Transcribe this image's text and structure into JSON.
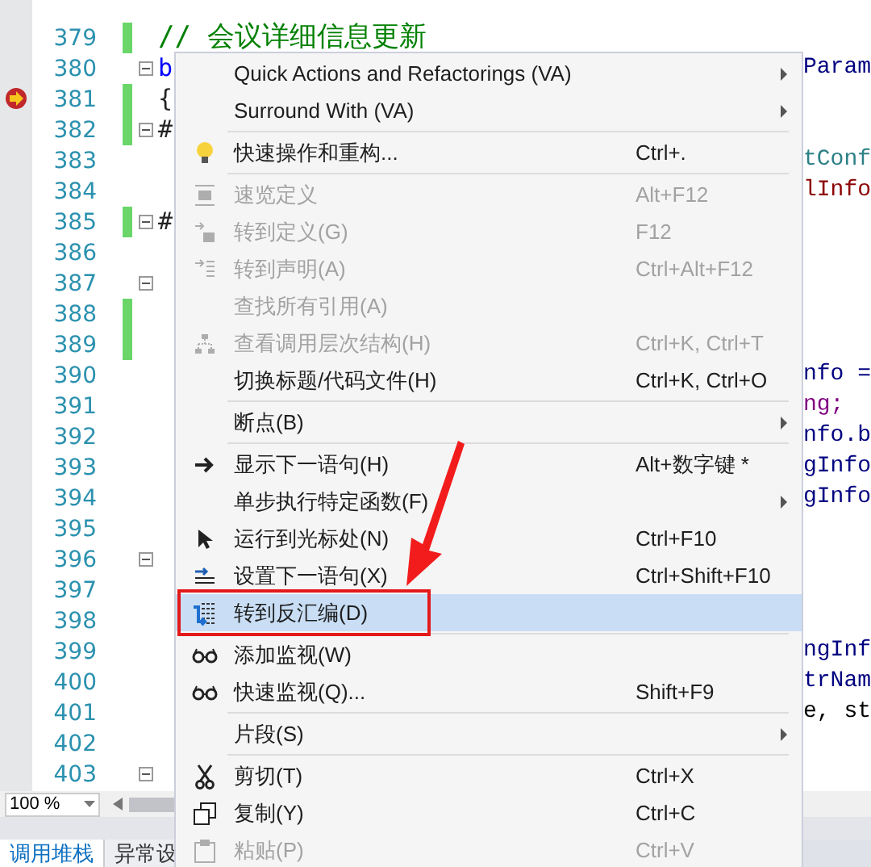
{
  "editor": {
    "lines": [
      {
        "number": "379",
        "changed": true,
        "code_left": {
          "text": "// 会议详细信息更新",
          "color": "#008000"
        }
      },
      {
        "number": "380",
        "fold": true,
        "code_left": {
          "text": "b",
          "color": "#0000ff"
        },
        "code_right": {
          "text": "Param",
          "color": "#000080"
        }
      },
      {
        "number": "381",
        "changed": true,
        "current": true,
        "code_left": {
          "text": "{",
          "color": "#222222"
        }
      },
      {
        "number": "382",
        "changed": true,
        "fold": true,
        "code_left": {
          "text": "#",
          "color": "#222222"
        }
      },
      {
        "number": "383",
        "code_right": {
          "text": "tConf",
          "color": "#2b7f86"
        }
      },
      {
        "number": "384",
        "code_right": {
          "text": "lInfo",
          "color": "#8b0000"
        }
      },
      {
        "number": "385",
        "changed": true,
        "fold": true,
        "code_left": {
          "text": "#",
          "color": "#222222"
        }
      },
      {
        "number": "386"
      },
      {
        "number": "387",
        "fold": true
      },
      {
        "number": "388",
        "changed": true
      },
      {
        "number": "389",
        "changed": true
      },
      {
        "number": "390",
        "code_right": {
          "text": "nfo =",
          "color": "#000080"
        }
      },
      {
        "number": "391",
        "code_right": {
          "text": "ng;",
          "color": "#800080"
        }
      },
      {
        "number": "392",
        "code_right": {
          "text": "nfo.b",
          "color": "#000080"
        }
      },
      {
        "number": "393",
        "code_right": {
          "text": "gInfo",
          "color": "#000080"
        }
      },
      {
        "number": "394",
        "code_right": {
          "text": "gInfo",
          "color": "#000080"
        }
      },
      {
        "number": "395"
      },
      {
        "number": "396",
        "fold": true
      },
      {
        "number": "397"
      },
      {
        "number": "398"
      },
      {
        "number": "399",
        "code_right": {
          "text": "ngInf",
          "color": "#000080"
        }
      },
      {
        "number": "400",
        "code_right": {
          "text": "trNam",
          "color": "#000080"
        }
      },
      {
        "number": "401",
        "code_right": {
          "text": "e, st",
          "color": "#000000"
        }
      },
      {
        "number": "402"
      },
      {
        "number": "403",
        "fold": true
      }
    ],
    "zoom": "100 %"
  },
  "context_menu": {
    "items": [
      {
        "kind": "item",
        "label": "Quick Actions and Refactorings (VA)",
        "submenu": true,
        "disabled": false,
        "selected": false
      },
      {
        "kind": "item",
        "label": "Surround With (VA)",
        "submenu": true,
        "disabled": false,
        "selected": false
      },
      {
        "kind": "separator"
      },
      {
        "kind": "item",
        "label": "快速操作和重构...",
        "shortcut": "Ctrl+.",
        "disabled": false,
        "selected": false
      },
      {
        "kind": "separator"
      },
      {
        "kind": "item",
        "label": "速览定义",
        "shortcut": "Alt+F12",
        "disabled": true,
        "selected": false
      },
      {
        "kind": "item",
        "label": "转到定义(G)",
        "shortcut": "F12",
        "disabled": true,
        "selected": false
      },
      {
        "kind": "item",
        "label": "转到声明(A)",
        "shortcut": "Ctrl+Alt+F12",
        "disabled": true,
        "selected": false
      },
      {
        "kind": "item",
        "label": "查找所有引用(A)",
        "disabled": true,
        "selected": false
      },
      {
        "kind": "item",
        "label": "查看调用层次结构(H)",
        "shortcut": "Ctrl+K, Ctrl+T",
        "disabled": true,
        "selected": false
      },
      {
        "kind": "item",
        "label": "切换标题/代码文件(H)",
        "shortcut": "Ctrl+K, Ctrl+O",
        "disabled": false,
        "selected": false
      },
      {
        "kind": "separator"
      },
      {
        "kind": "item",
        "label": "断点(B)",
        "submenu": true,
        "disabled": false,
        "selected": false
      },
      {
        "kind": "separator"
      },
      {
        "kind": "item",
        "label": "显示下一语句(H)",
        "shortcut": "Alt+数字键 *",
        "disabled": false,
        "selected": false
      },
      {
        "kind": "item",
        "label": "单步执行特定函数(F)",
        "submenu": true,
        "disabled": false,
        "selected": false
      },
      {
        "kind": "item",
        "label": "运行到光标处(N)",
        "shortcut": "Ctrl+F10",
        "disabled": false,
        "selected": false
      },
      {
        "kind": "item",
        "label": "设置下一语句(X)",
        "shortcut": "Ctrl+Shift+F10",
        "disabled": false,
        "selected": false
      },
      {
        "kind": "item",
        "label": "转到反汇编(D)",
        "disabled": false,
        "selected": true,
        "framed": true
      },
      {
        "kind": "separator"
      },
      {
        "kind": "item",
        "label": "添加监视(W)",
        "disabled": false,
        "selected": false
      },
      {
        "kind": "item",
        "label": "快速监视(Q)...",
        "shortcut": "Shift+F9",
        "disabled": false,
        "selected": false
      },
      {
        "kind": "separator"
      },
      {
        "kind": "item",
        "label": "片段(S)",
        "submenu": true,
        "disabled": false,
        "selected": false
      },
      {
        "kind": "separator"
      },
      {
        "kind": "item",
        "label": "剪切(T)",
        "shortcut": "Ctrl+X",
        "disabled": false,
        "selected": false
      },
      {
        "kind": "item",
        "label": "复制(Y)",
        "shortcut": "Ctrl+C",
        "disabled": false,
        "selected": false
      },
      {
        "kind": "item",
        "label": "粘贴(P)",
        "shortcut": "Ctrl+V",
        "disabled": true,
        "selected": false
      }
    ]
  },
  "bottom_tabs": [
    {
      "label": "调用堆栈",
      "selected": true
    },
    {
      "label": "异常设",
      "selected": false
    }
  ]
}
